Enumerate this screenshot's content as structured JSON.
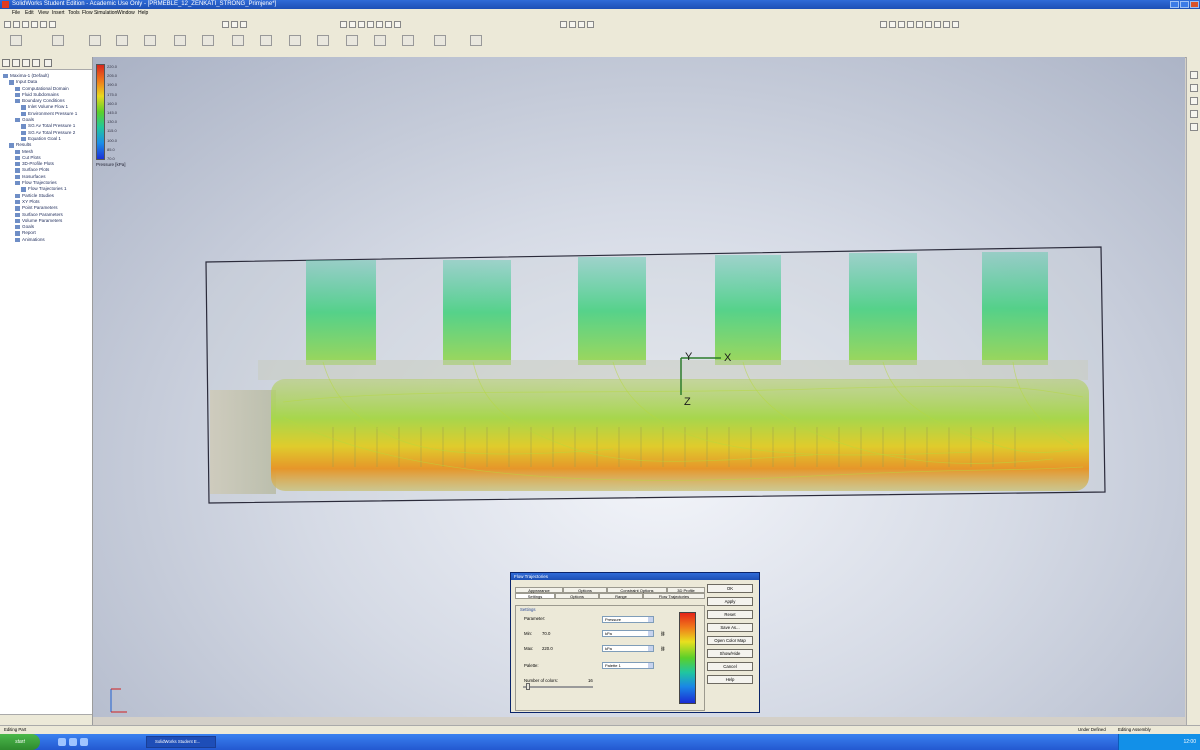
{
  "window": {
    "title": "SolidWorks Student Edition - Academic Use Only - [PRMEBLE_12_ZENKATI_STRONG_Primjene*]"
  },
  "menu": {
    "items": [
      "File",
      "Edit",
      "View",
      "Insert",
      "Tools",
      "Flow Simulation",
      "Window",
      "Help"
    ]
  },
  "sidebar": {
    "tree": [
      {
        "label": "Maxima-1 (Default)",
        "indent": 0
      },
      {
        "label": "Input Data",
        "indent": 1
      },
      {
        "label": "Computational Domain",
        "indent": 2
      },
      {
        "label": "Fluid Subdomains",
        "indent": 2
      },
      {
        "label": "Boundary Conditions",
        "indent": 2
      },
      {
        "label": "Inlet Volume Flow 1",
        "indent": 3
      },
      {
        "label": "Environment Pressure 1",
        "indent": 3
      },
      {
        "label": "Goals",
        "indent": 2
      },
      {
        "label": "SG Av Total Pressure 1",
        "indent": 3
      },
      {
        "label": "SG Av Total Pressure 2",
        "indent": 3
      },
      {
        "label": "Equation Goal 1",
        "indent": 3
      },
      {
        "label": "Results",
        "indent": 1
      },
      {
        "label": "Mesh",
        "indent": 2
      },
      {
        "label": "Cut Plots",
        "indent": 2
      },
      {
        "label": "3D-Profile Plots",
        "indent": 2
      },
      {
        "label": "Surface Plots",
        "indent": 2
      },
      {
        "label": "Isosurfaces",
        "indent": 2
      },
      {
        "label": "Flow Trajectories",
        "indent": 2
      },
      {
        "label": "Flow Trajectories 1",
        "indent": 3
      },
      {
        "label": "Particle Studies",
        "indent": 2
      },
      {
        "label": "XY Plots",
        "indent": 2
      },
      {
        "label": "Point Parameters",
        "indent": 2
      },
      {
        "label": "Surface Parameters",
        "indent": 2
      },
      {
        "label": "Volume Parameters",
        "indent": 2
      },
      {
        "label": "Goals",
        "indent": 2
      },
      {
        "label": "Report",
        "indent": 2
      },
      {
        "label": "Animations",
        "indent": 2
      }
    ]
  },
  "legend": {
    "ticks": [
      "220.0",
      "205.0",
      "190.0",
      "175.0",
      "160.0",
      "145.0",
      "130.0",
      "115.0",
      "100.0",
      "85.0",
      "70.0"
    ],
    "caption": "Pressure [kPa]"
  },
  "viewport": {
    "axis_x": "X",
    "axis_y": "Y",
    "axis_z": "Z"
  },
  "dialog": {
    "title": "Flow Trajectories",
    "tabs_row1": [
      "Appearance",
      "Options",
      "Constraint Options",
      "3D Profile"
    ],
    "tabs_row2": [
      "Settings",
      "Options",
      "Range",
      "Flow Trajectories"
    ],
    "group_label": "Settings",
    "parameter_label": "Parameter:",
    "parameter_value": "Pressure",
    "min_label": "Min:",
    "min_value": "70.0",
    "min_units": "kPa",
    "max_label": "Max:",
    "max_value": "220.0",
    "max_units": "kPa",
    "palette_label": "Palette:",
    "palette_value": "Palette 1",
    "levels_label": "Number of colors:",
    "levels_value": "16",
    "buttons": [
      "OK",
      "Apply",
      "Reset",
      "Save As...",
      "Open Color Map",
      "Show/Hide",
      "Cancel",
      "Help"
    ]
  },
  "statusbar": {
    "left": "Editing Part",
    "mid": "Under Defined",
    "right": "Editing Assembly"
  },
  "taskbar": {
    "start_label": "start",
    "task_label": "SolidWorks Student E...",
    "clock": "12:00"
  }
}
